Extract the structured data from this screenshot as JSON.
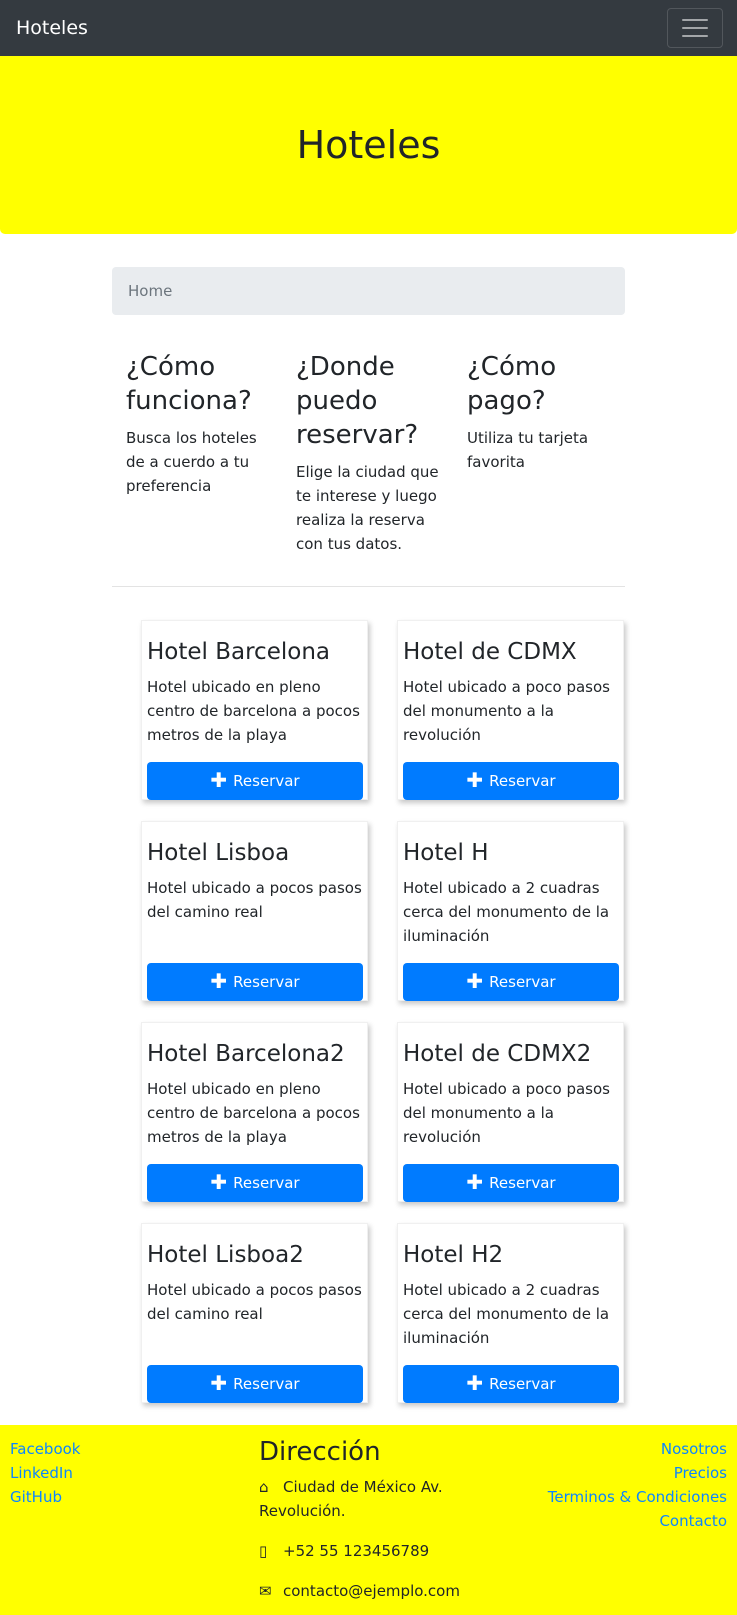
{
  "navbar": {
    "brand": "Hoteles",
    "toggle_icon": "hamburger-icon"
  },
  "hero": {
    "title": "Hoteles"
  },
  "breadcrumb": {
    "home": "Home"
  },
  "info": [
    {
      "title": "¿Cómo funciona?",
      "text": "Busca los hoteles de a cuerdo a tu preferencia"
    },
    {
      "title": "¿Donde puedo reservar?",
      "text": "Elige la ciudad que te interese y luego realiza la reserva con tus datos."
    },
    {
      "title": "¿Cómo pago?",
      "text": "Utiliza tu tarjeta favorita"
    }
  ],
  "hotels": [
    {
      "name": "Hotel Barcelona",
      "desc": "Hotel ubicado en pleno centro de barcelona a pocos metros de la playa",
      "button": "Reservar"
    },
    {
      "name": "Hotel de CDMX",
      "desc": "Hotel ubicado a poco pasos del monumento a la revolución",
      "button": "Reservar"
    },
    {
      "name": "Hotel Lisboa",
      "desc": "Hotel ubicado a pocos pasos del camino real",
      "button": "Reservar"
    },
    {
      "name": "Hotel H",
      "desc": "Hotel ubicado a 2 cuadras cerca del monumento de la iluminación",
      "button": "Reservar"
    },
    {
      "name": "Hotel Barcelona2",
      "desc": "Hotel ubicado en pleno centro de barcelona a pocos metros de la playa",
      "button": "Reservar"
    },
    {
      "name": "Hotel de CDMX2",
      "desc": "Hotel ubicado a poco pasos del monumento a la revolución",
      "button": "Reservar"
    },
    {
      "name": "Hotel Lisboa2",
      "desc": "Hotel ubicado a pocos pasos del camino real",
      "button": "Reservar"
    },
    {
      "name": "Hotel H2",
      "desc": "Hotel ubicado a 2 cuadras cerca del monumento de la iluminación",
      "button": "Reservar"
    }
  ],
  "footer": {
    "social": [
      "Facebook",
      "LinkedIn",
      "GitHub"
    ],
    "address_title": "Dirección",
    "address": "Ciudad de México Av. Revolución.",
    "phone": "+52 55 123456789",
    "email": "contacto@ejemplo.com",
    "links": [
      "Nosotros",
      "Precios",
      "Terminos & Condiciones",
      "Contacto"
    ]
  },
  "colors": {
    "navbar": "#343a40",
    "accent_yellow": "#ffff00",
    "button_blue": "#007bff",
    "link_blue": "#0d86ff"
  }
}
